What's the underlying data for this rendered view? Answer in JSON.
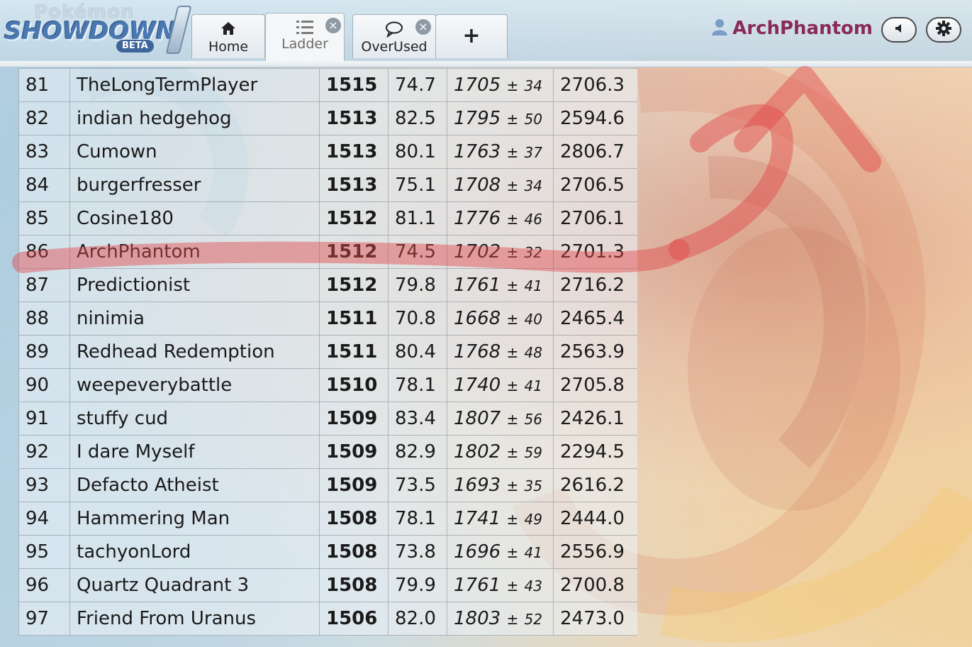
{
  "header": {
    "logo": {
      "brand_top": "Pokémon",
      "brand_main": "SHOWDOWN",
      "badge": "BETA"
    },
    "tabs": [
      {
        "label": "Home",
        "icon": "home-icon",
        "closable": false,
        "active": false
      },
      {
        "label": "Ladder",
        "icon": "list-icon",
        "closable": true,
        "active": true
      },
      {
        "label": "OverUsed",
        "icon": "chat-bubble-icon",
        "closable": true,
        "active": false
      },
      {
        "label": "+",
        "icon": "plus-icon",
        "closable": false,
        "active": false
      }
    ],
    "user": {
      "name": "ArchPhantom",
      "icon": "user-icon",
      "name_color": "#8a2a5a"
    },
    "buttons": [
      {
        "icon": "volume-icon"
      },
      {
        "icon": "gear-icon"
      }
    ]
  },
  "ladder": {
    "rows": [
      {
        "rank": "81",
        "name": "TheLongTermPlayer",
        "elo": "1515",
        "gxe": "74.7",
        "glicko": "1705",
        "dev": "34",
        "coil": "2706.3"
      },
      {
        "rank": "82",
        "name": "indian hedgehog",
        "elo": "1513",
        "gxe": "82.5",
        "glicko": "1795",
        "dev": "50",
        "coil": "2594.6"
      },
      {
        "rank": "83",
        "name": "Cumown",
        "elo": "1513",
        "gxe": "80.1",
        "glicko": "1763",
        "dev": "37",
        "coil": "2806.7"
      },
      {
        "rank": "84",
        "name": "burgerfresser",
        "elo": "1513",
        "gxe": "75.1",
        "glicko": "1708",
        "dev": "34",
        "coil": "2706.5"
      },
      {
        "rank": "85",
        "name": "Cosine180",
        "elo": "1512",
        "gxe": "81.1",
        "glicko": "1776",
        "dev": "46",
        "coil": "2706.1"
      },
      {
        "rank": "86",
        "name": "ArchPhantom",
        "elo": "1512",
        "gxe": "74.5",
        "glicko": "1702",
        "dev": "32",
        "coil": "2701.3"
      },
      {
        "rank": "87",
        "name": "Predictionist",
        "elo": "1512",
        "gxe": "79.8",
        "glicko": "1761",
        "dev": "41",
        "coil": "2716.2"
      },
      {
        "rank": "88",
        "name": "ninimia",
        "elo": "1511",
        "gxe": "70.8",
        "glicko": "1668",
        "dev": "40",
        "coil": "2465.4"
      },
      {
        "rank": "89",
        "name": "Redhead Redemption",
        "elo": "1511",
        "gxe": "80.4",
        "glicko": "1768",
        "dev": "48",
        "coil": "2563.9"
      },
      {
        "rank": "90",
        "name": "weepeverybattle",
        "elo": "1510",
        "gxe": "78.1",
        "glicko": "1740",
        "dev": "41",
        "coil": "2705.8"
      },
      {
        "rank": "91",
        "name": "stuffy cud",
        "elo": "1509",
        "gxe": "83.4",
        "glicko": "1807",
        "dev": "56",
        "coil": "2426.1"
      },
      {
        "rank": "92",
        "name": "I dare Myself",
        "elo": "1509",
        "gxe": "82.9",
        "glicko": "1802",
        "dev": "59",
        "coil": "2294.5"
      },
      {
        "rank": "93",
        "name": "Defacto Atheist",
        "elo": "1509",
        "gxe": "73.5",
        "glicko": "1693",
        "dev": "35",
        "coil": "2616.2"
      },
      {
        "rank": "94",
        "name": "Hammering Man",
        "elo": "1508",
        "gxe": "78.1",
        "glicko": "1741",
        "dev": "49",
        "coil": "2444.0"
      },
      {
        "rank": "95",
        "name": "tachyonLord",
        "elo": "1508",
        "gxe": "73.8",
        "glicko": "1696",
        "dev": "41",
        "coil": "2556.9"
      },
      {
        "rank": "96",
        "name": "Quartz Quadrant 3",
        "elo": "1508",
        "gxe": "79.9",
        "glicko": "1761",
        "dev": "43",
        "coil": "2700.8"
      },
      {
        "rank": "97",
        "name": "Friend From Uranus",
        "elo": "1506",
        "gxe": "82.0",
        "glicko": "1803",
        "dev": "52",
        "coil": "2473.0"
      }
    ],
    "plus_minus": "±"
  },
  "colors": {
    "annotation": "#e0474a",
    "username": "#8a2a5a"
  }
}
